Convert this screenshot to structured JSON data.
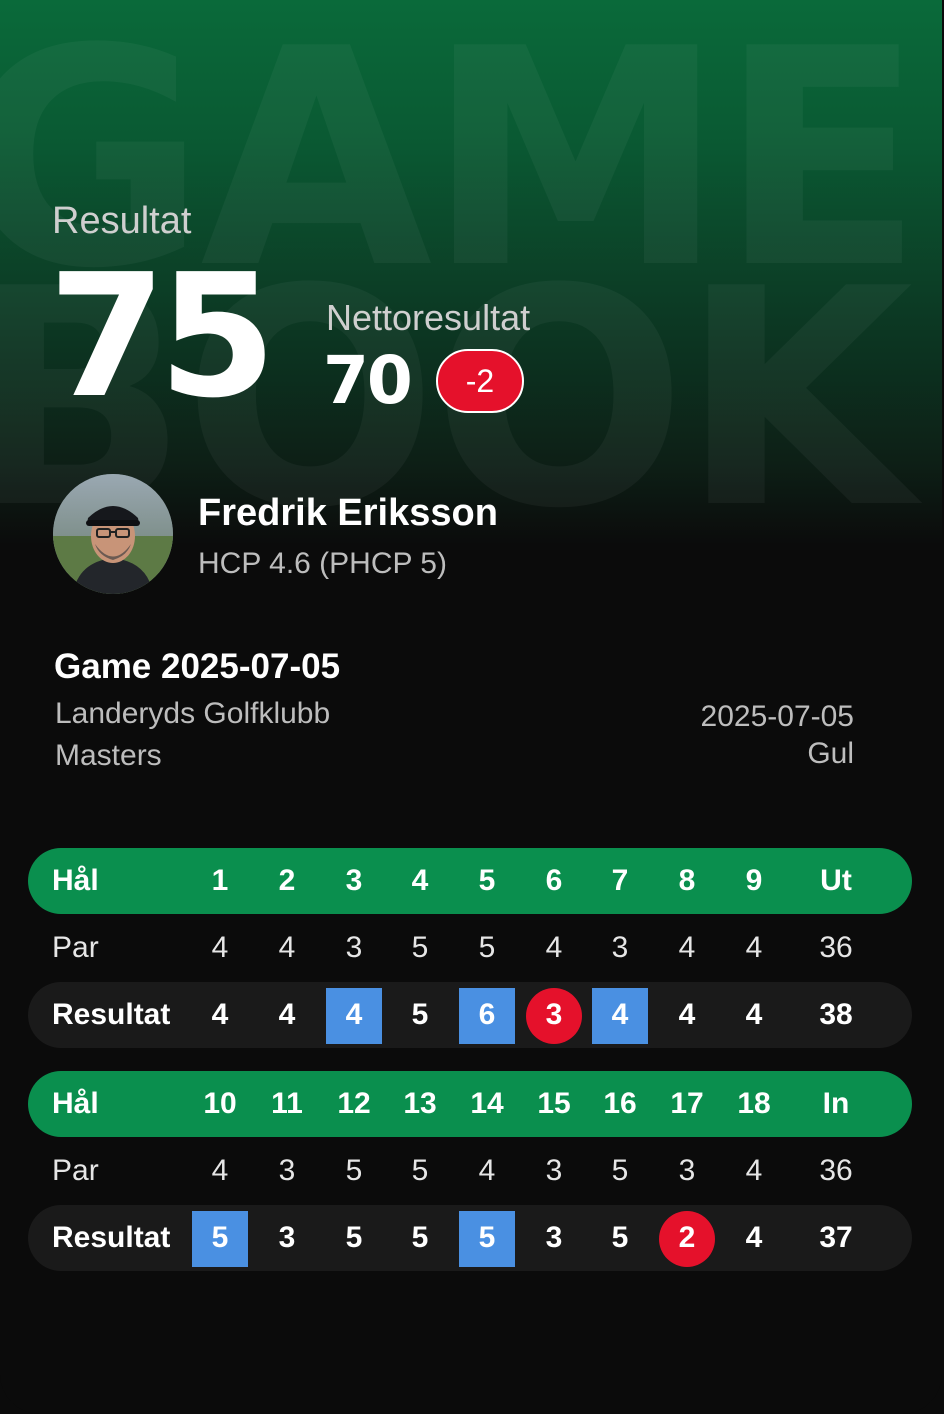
{
  "hero": {
    "watermark_line1": "GAME",
    "watermark_line2": "BOOK",
    "result_label": "Resultat",
    "score": "75",
    "netto_label": "Nettoresultat",
    "netto_score": "70",
    "netto_diff": "-2"
  },
  "player": {
    "name": "Fredrik Eriksson",
    "hcp": "HCP 4.6 (PHCP 5)"
  },
  "game": {
    "title": "Game 2025-07-05",
    "club": "Landeryds Golfklubb",
    "course": "Masters",
    "date": "2025-07-05",
    "tee": "Gul"
  },
  "scorecard": {
    "front": {
      "header_label": "Hål",
      "holes": [
        "1",
        "2",
        "3",
        "4",
        "5",
        "6",
        "7",
        "8",
        "9"
      ],
      "total_label": "Ut",
      "par_label": "Par",
      "par": [
        "4",
        "4",
        "3",
        "5",
        "5",
        "4",
        "3",
        "4",
        "4"
      ],
      "par_total": "36",
      "result_label": "Resultat",
      "result": [
        "4",
        "4",
        "4",
        "5",
        "6",
        "3",
        "4",
        "4",
        "4"
      ],
      "result_total": "38",
      "marks": [
        "none",
        "none",
        "over",
        "none",
        "over",
        "under",
        "over",
        "none",
        "none"
      ]
    },
    "back": {
      "header_label": "Hål",
      "holes": [
        "10",
        "11",
        "12",
        "13",
        "14",
        "15",
        "16",
        "17",
        "18"
      ],
      "total_label": "In",
      "par_label": "Par",
      "par": [
        "4",
        "3",
        "5",
        "5",
        "4",
        "3",
        "5",
        "3",
        "4"
      ],
      "par_total": "36",
      "result_label": "Resultat",
      "result": [
        "5",
        "3",
        "5",
        "5",
        "5",
        "3",
        "5",
        "2",
        "4"
      ],
      "result_total": "37",
      "marks": [
        "over",
        "none",
        "none",
        "none",
        "over",
        "none",
        "none",
        "under",
        "none"
      ]
    }
  },
  "colors": {
    "header_green": "#0a8f4e",
    "over_par_blue": "#4a90e2",
    "under_par_red": "#e5112b"
  }
}
